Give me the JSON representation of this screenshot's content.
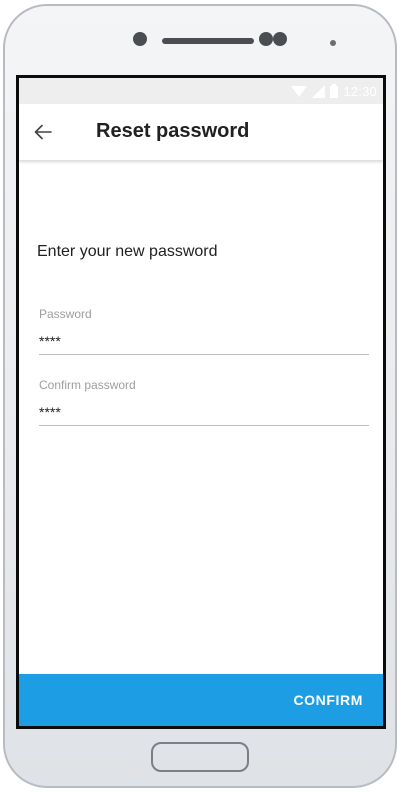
{
  "status_bar": {
    "time": "12:30",
    "icons": [
      "wifi-icon",
      "signal-icon",
      "battery-icon"
    ]
  },
  "app_bar": {
    "back_icon": "arrow-left-icon",
    "title": "Reset password"
  },
  "form": {
    "prompt": "Enter your new password",
    "password": {
      "label": "Password",
      "value": "****"
    },
    "confirm_password": {
      "label": "Confirm password",
      "value": "****"
    }
  },
  "actions": {
    "confirm_label": "CONFIRM"
  },
  "colors": {
    "accent": "#1d9de4",
    "status_bar": "#eeeeee",
    "title_text": "#212121",
    "hint_text": "#9e9e9e"
  }
}
